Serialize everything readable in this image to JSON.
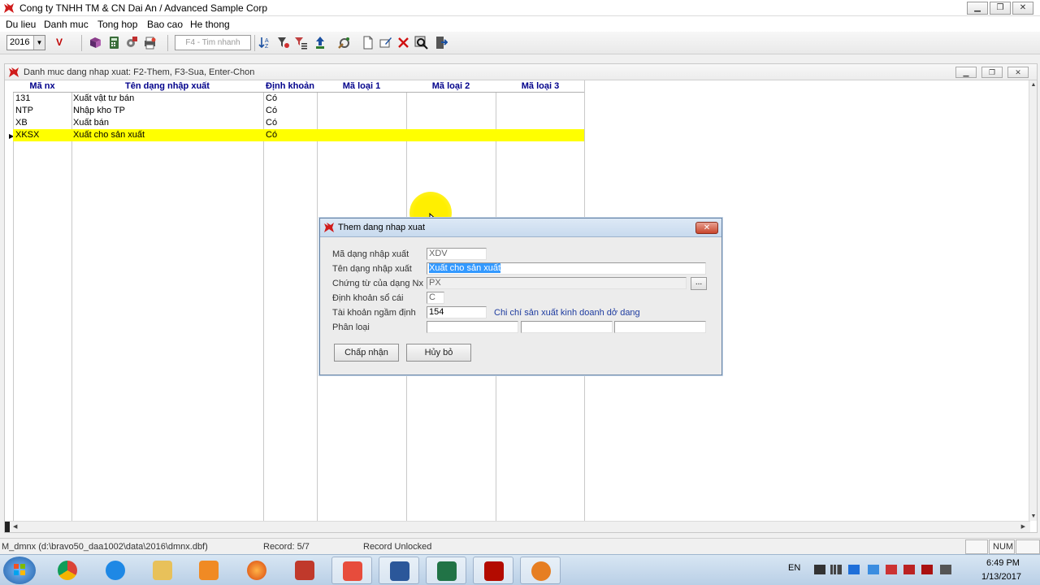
{
  "window": {
    "title": "Cong ty TNHH TM & CN Dai An / Advanced Sample Corp",
    "min": "▁",
    "max": "❐",
    "close": "✕"
  },
  "menu": [
    "Du lieu",
    "Danh muc",
    "Tong hop",
    "Bao cao",
    "He thong"
  ],
  "toolbar": {
    "year": "2016",
    "v_label": "V",
    "quick_search": "F4 - Tim nhanh"
  },
  "child": {
    "title": "Danh muc dang nhap xuat: F2-Them, F3-Sua, Enter-Chon",
    "min": "▁",
    "max": "❐",
    "close": "✕"
  },
  "grid": {
    "headers": [
      "Mã nx",
      "Tên dạng nhập xuất",
      "Định khoản",
      "Mã loại 1",
      "Mã loại 2",
      "Mã loại 3"
    ],
    "rows": [
      {
        "code": "131",
        "name": "Xuất vật tư bán",
        "entry": "Có"
      },
      {
        "code": "NTP",
        "name": "Nhập kho TP",
        "entry": "Có"
      },
      {
        "code": "XB",
        "name": "Xuất bán",
        "entry": "Có"
      },
      {
        "code": "XKSX",
        "name": "Xuất cho sản xuất",
        "entry": "Có"
      }
    ]
  },
  "status": {
    "file": "M_dmnx (d:\\bravo50_daa1002\\data\\2016\\dmnx.dbf)",
    "record": "Record: 5/7",
    "lock": "Record Unlocked",
    "num": "NUM"
  },
  "dialog": {
    "title": "Them dang nhap xuat",
    "close": "✕",
    "labels": {
      "code": "Mã dạng nhập xuất",
      "name": "Tên dạng nhập xuất",
      "voucher": "Chứng từ của dạng Nx",
      "ledger": "Định khoản sổ cái",
      "account": "Tài khoản ngầm định",
      "category": "Phân loại"
    },
    "values": {
      "code": "XDV",
      "name": "Xuất cho sản xuất",
      "voucher": "PX",
      "ledger": "C",
      "account": "154",
      "account_desc": "Chi chí sản xuất kinh doanh dở dang"
    },
    "ellipsis": "...",
    "accept": "Chấp nhận",
    "cancel": "Hủy bỏ"
  },
  "tray": {
    "lang": "EN",
    "time": "6:49 PM",
    "date": "1/13/2017"
  },
  "colors": {
    "selected_row": "#ffff00",
    "header_text": "#00008b",
    "highlight": "#3399ff"
  }
}
